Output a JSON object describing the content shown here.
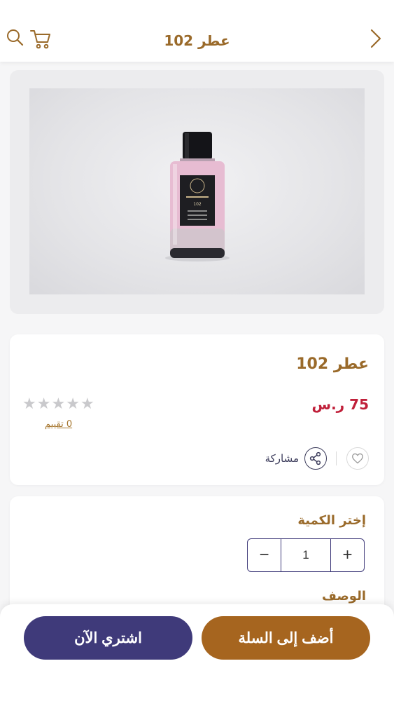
{
  "header": {
    "title": "عطر 102",
    "icons": [
      "search-icon",
      "cart-icon",
      "chevron-right-icon"
    ]
  },
  "product": {
    "name": "عطر 102",
    "price": "75 ر.س",
    "rating_stars": 0,
    "rating_max": 5,
    "rating_link": "0  تقييم",
    "share_label": "مشاركة",
    "bottle_label_number": "102"
  },
  "quantity": {
    "title": "إختر الكمية",
    "value": "1",
    "minus": "−",
    "plus": "+"
  },
  "description": {
    "title": "الوصف"
  },
  "actions": {
    "add_to_cart": "أضف إلى السلة",
    "buy_now": "اشتري الآن"
  },
  "colors": {
    "brand_gold": "#a6651f",
    "brand_purple": "#3f3a7a",
    "price_red": "#c0203a",
    "star_empty": "#c9c9cc"
  }
}
